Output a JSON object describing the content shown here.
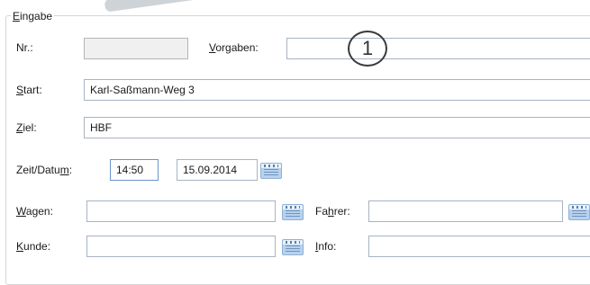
{
  "group": {
    "title": "Eingabe",
    "title_mnemonic": "E",
    "title_rest": "ingabe"
  },
  "fields": {
    "nr": {
      "label": "Nr.:",
      "value": ""
    },
    "vorgaben": {
      "label_mnemonic": "V",
      "label_rest": "orgaben:",
      "value": ""
    },
    "start": {
      "label_mnemonic": "S",
      "label_rest": "tart:",
      "value": "Karl-Saßmann-Weg 3"
    },
    "ziel": {
      "label_mnemonic": "Z",
      "label_rest": "iel:",
      "value": "HBF"
    },
    "zeit_datum": {
      "label_pre": "Zeit/Datu",
      "label_mnemonic": "m",
      "label_post": ":",
      "time": "14:50",
      "date": "15.09.2014"
    },
    "wagen": {
      "label_mnemonic": "W",
      "label_rest": "agen:",
      "value": ""
    },
    "fahrer": {
      "label_pre": "Fa",
      "label_mnemonic": "h",
      "label_post": "rer:",
      "value": ""
    },
    "kunde": {
      "label_mnemonic": "K",
      "label_rest": "unde:",
      "value": ""
    },
    "info": {
      "label_mnemonic": "I",
      "label_rest": "nfo:",
      "value": ""
    }
  },
  "annotation": {
    "marker": "1"
  },
  "icons": [
    "calendar-icon",
    "lookup-icon"
  ]
}
